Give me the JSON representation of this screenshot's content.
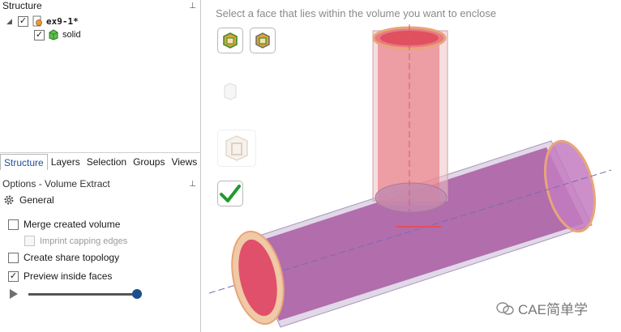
{
  "structure_panel": {
    "title": "Structure",
    "tree": {
      "root_label": "ex9-1*",
      "child_label": "solid"
    }
  },
  "tabs": [
    "Structure",
    "Layers",
    "Selection",
    "Groups",
    "Views"
  ],
  "options_panel": {
    "title": "Options - Volume Extract",
    "section_label": "General",
    "options": [
      {
        "label": "Merge created volume",
        "checked": false,
        "enabled": true
      },
      {
        "label": "Imprint capping edges",
        "checked": false,
        "enabled": false
      },
      {
        "label": "Create share topology",
        "checked": false,
        "enabled": true
      },
      {
        "label": "Preview inside faces",
        "checked": true,
        "enabled": true
      }
    ],
    "slider_value_fraction": 1.0
  },
  "viewport": {
    "prompt": "Select a face that lies within the volume you want to enclose",
    "watermark": "CAE简单学"
  },
  "colors": {
    "accent": "#1f4e9a",
    "pipe_fill": "#a04a98",
    "branch_fill": "#e87a84",
    "check_green": "#1f9a2e"
  }
}
